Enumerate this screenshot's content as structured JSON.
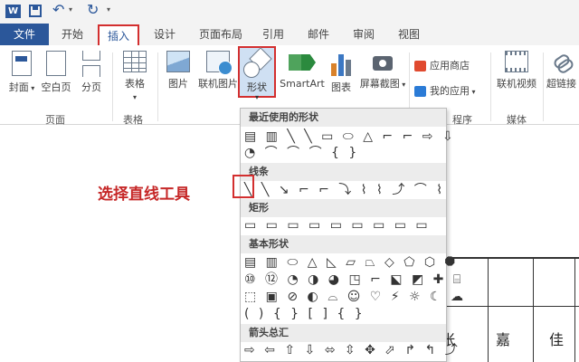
{
  "qat": {
    "app_icon": "W"
  },
  "tabs": {
    "file": "文件",
    "home": "开始",
    "insert": "插入",
    "design": "设计",
    "layout": "页面布局",
    "references": "引用",
    "mailings": "邮件",
    "review": "审阅",
    "view": "视图"
  },
  "ribbon": {
    "cover": "封面",
    "blank_page": "空白页",
    "page_break": "分页",
    "group_pages": "页面",
    "table": "表格",
    "group_tables": "表格",
    "picture": "图片",
    "online_picture": "联机图片",
    "shapes": "形状",
    "smartart": "SmartArt",
    "chart": "图表",
    "screenshot": "屏幕截图",
    "app_store": "应用商店",
    "my_apps": "我的应用",
    "group_apps_partial": "程序",
    "online_video": "联机视频",
    "group_media": "媒体",
    "hyperlink": "超链接"
  },
  "dropdown": {
    "recent_header": "最近使用的形状",
    "recent_row1": "▤ ▥ ╲ ╲ ▭ ⬭ △ ⌐ ⌐ ⇨ ⇩",
    "recent_row2": "◔ ⌒ ⌒ ⌒ { }",
    "lines_header": "线条",
    "lines_row": "╲ ╲ ↘ ⌐ ⌐ ⤵ ⌇ ⌇ ⤴ ⌒ ⌇",
    "rect_header": "矩形",
    "rect_row": "▭ ▭ ▭ ▭ ▭ ▭ ▭ ▭ ▭",
    "basic_header": "基本形状",
    "basic_row1": "▤ ▥ ⬭ △ ◺ ▱ ⏢ ◇ ⬠ ⬡ ⯃",
    "basic_row2": "⑩ ⑫ ◔ ◑ ◕ ◳ ⌐ ⬕ ◩ ✚ ⌸",
    "basic_row3": "⬚ ▣ ⊘ ◐ ⌓ ☺ ♡ ⚡ ☼ ☾ ☁",
    "basic_row4": "( ) { } [ ] { }",
    "arrows_header": "箭头总汇",
    "arrows_row": "⇨ ⇦ ⇧ ⇩ ⬄ ⇳ ✥ ⬀ ↱ ↰ ⤴"
  },
  "annotation": "选择直线工具",
  "document": {
    "char1": "张",
    "char2": "嘉",
    "char3": "佳"
  }
}
